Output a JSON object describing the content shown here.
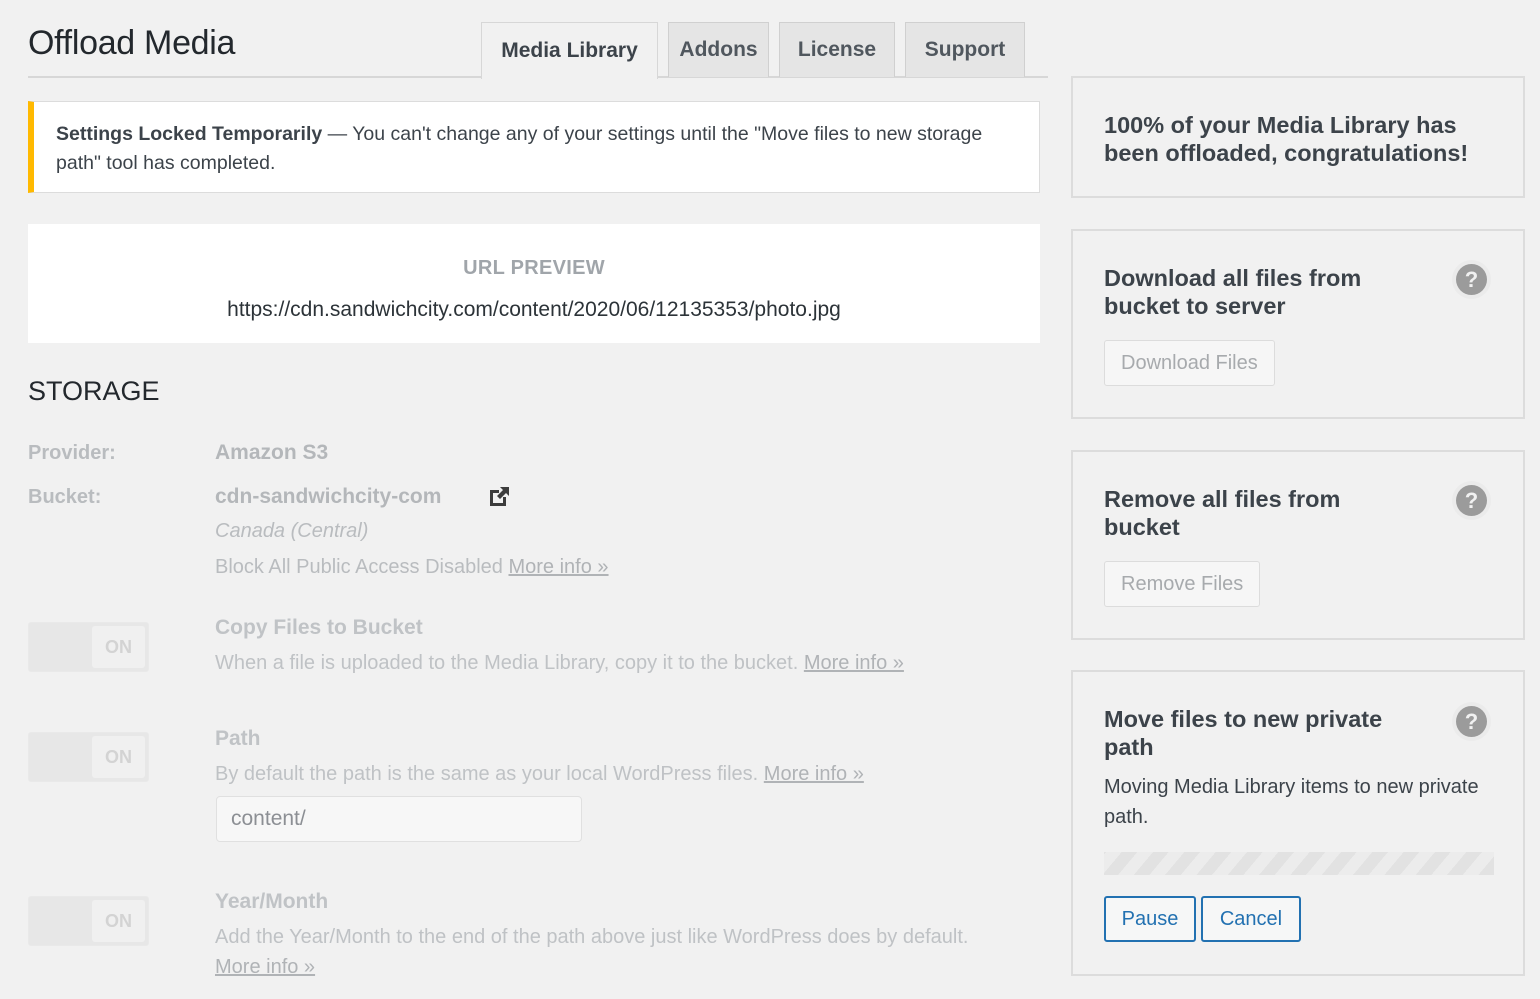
{
  "header": {
    "title": "Offload Media",
    "tabs": [
      {
        "label": "Media Library",
        "active": true
      },
      {
        "label": "Addons",
        "active": false
      },
      {
        "label": "License",
        "active": false
      },
      {
        "label": "Support",
        "active": false
      }
    ]
  },
  "notice": {
    "title": "Settings Locked Temporarily",
    "separator": " — ",
    "message": "You can't change any of your settings until the \"Move files to new storage path\" tool has completed.",
    "accent_color": "#ffb900"
  },
  "url_preview": {
    "label": "URL PREVIEW",
    "url": "https://cdn.sandwichcity.com/content/2020/06/12135353/photo.jpg"
  },
  "storage": {
    "section_title": "STORAGE",
    "provider_label": "Provider:",
    "provider_value": "Amazon S3",
    "bucket_label": "Bucket:",
    "bucket_value": "cdn-sandwichcity-com",
    "region": "Canada (Central)",
    "public_access_text": "Block All Public Access Disabled",
    "public_access_link": "More info »",
    "settings": [
      {
        "toggle": "ON",
        "title": "Copy Files to Bucket",
        "description": "When a file is uploaded to the Media Library, copy it to the bucket.",
        "link": "More info »"
      },
      {
        "toggle": "ON",
        "title": "Path",
        "description": "By default the path is the same as your local WordPress files.",
        "link": "More info »",
        "input_value": "content/"
      },
      {
        "toggle": "ON",
        "title": "Year/Month",
        "description": "Add the Year/Month to the end of the path above just like WordPress does by default.",
        "link": "More info »"
      }
    ]
  },
  "sidebar": {
    "offload_status": "100% of your Media Library has been offloaded, congratulations!",
    "download": {
      "title": "Download all files from bucket to server",
      "button": "Download Files"
    },
    "remove": {
      "title": "Remove all files from bucket",
      "button": "Remove Files"
    },
    "move": {
      "title": "Move files to new private path",
      "description": "Moving Media Library items to new private path.",
      "progress_state": "indeterminate",
      "pause_button": "Pause",
      "cancel_button": "Cancel",
      "button_color": "#2271b1"
    },
    "help_icon_glyph": "?"
  }
}
